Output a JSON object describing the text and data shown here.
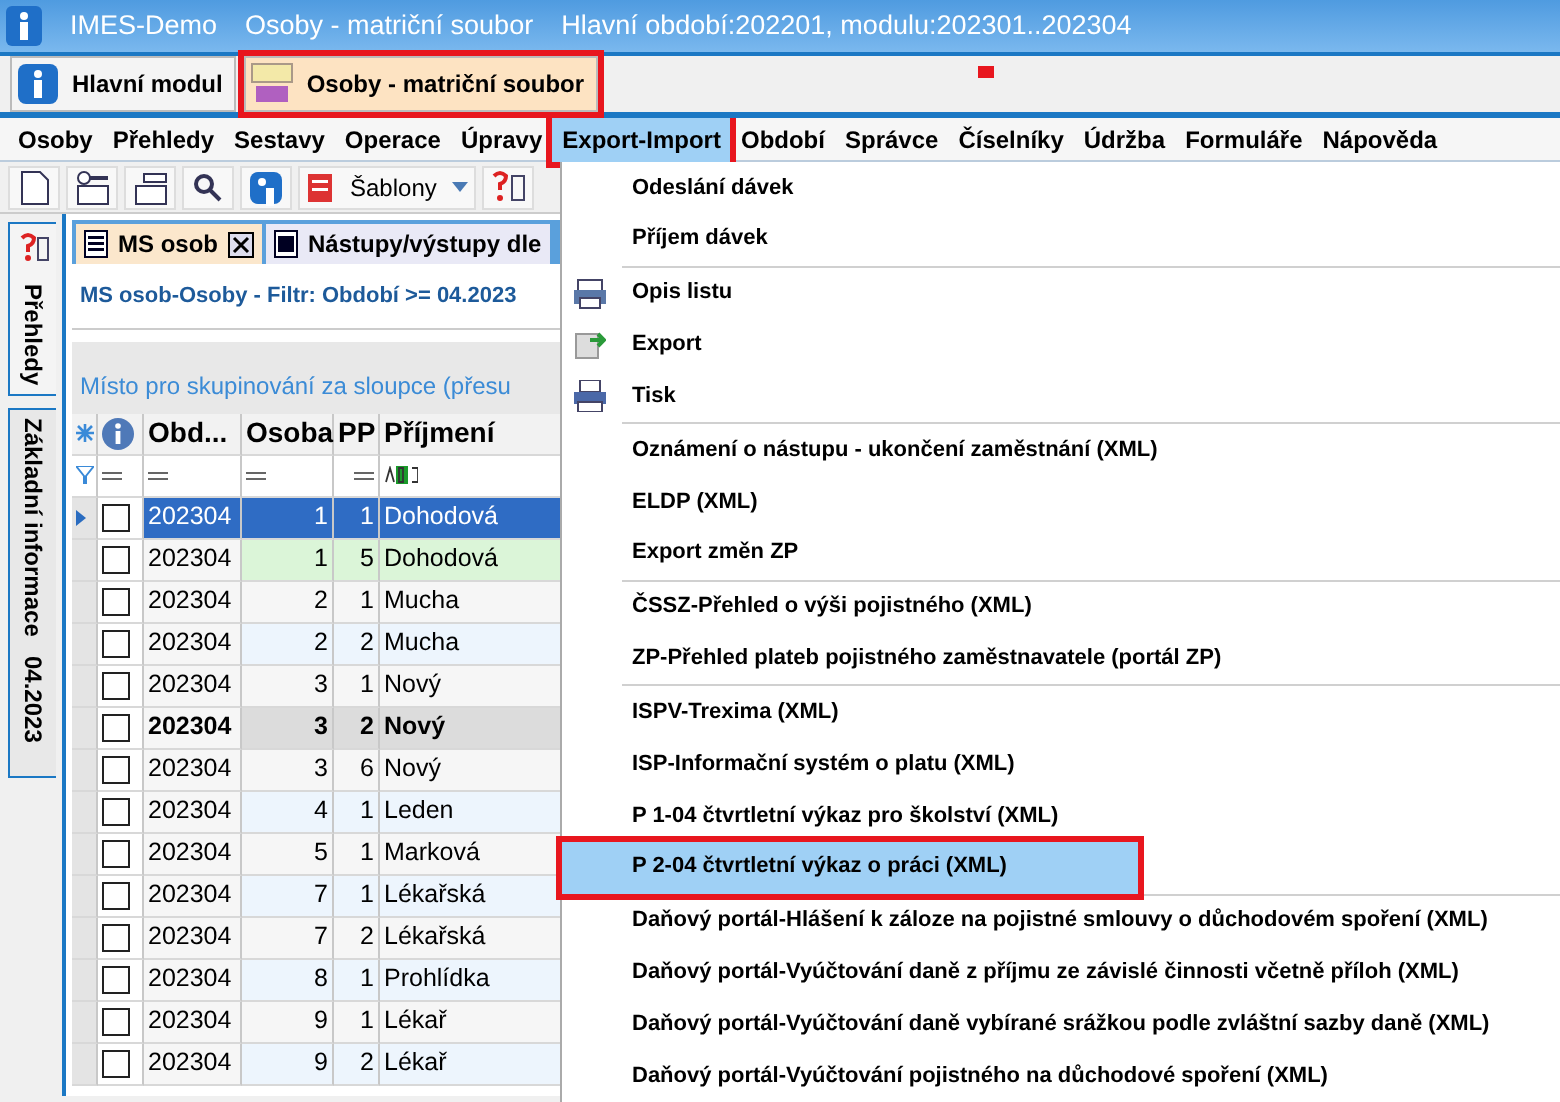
{
  "window": {
    "title": "IMES-Demo",
    "document": "Osoby - matriční soubor",
    "period": "Hlavní období:202201, modulu:202301..202304"
  },
  "module_tabs": [
    {
      "label": "Hlavní modul",
      "selected": false,
      "marked": false,
      "kind": "info"
    },
    {
      "label": "Osoby - matriční soubor",
      "selected": true,
      "marked": true,
      "kind": "ms"
    }
  ],
  "menu": [
    {
      "label": "Osoby",
      "open": false,
      "marked": false
    },
    {
      "label": "Přehledy",
      "open": false,
      "marked": false
    },
    {
      "label": "Sestavy",
      "open": false,
      "marked": false
    },
    {
      "label": "Operace",
      "open": false,
      "marked": false
    },
    {
      "label": "Úpravy",
      "open": false,
      "marked": false
    },
    {
      "label": "Export-Import",
      "open": true,
      "marked": true
    },
    {
      "label": "Období",
      "open": false,
      "marked": false
    },
    {
      "label": "Správce",
      "open": false,
      "marked": false
    },
    {
      "label": "Číselníky",
      "open": false,
      "marked": false
    },
    {
      "label": "Údržba",
      "open": false,
      "marked": false
    },
    {
      "label": "Formuláře",
      "open": false,
      "marked": false
    },
    {
      "label": "Nápověda",
      "open": false,
      "marked": false
    }
  ],
  "toolbar": {
    "templates_button": "Šablony"
  },
  "side_tabs": [
    {
      "label": "Přehledy",
      "selected": false
    },
    {
      "label": "Základní informace",
      "extra": "04.2023",
      "selected": true
    }
  ],
  "doc_tabs": [
    {
      "label": "MS osob",
      "selected": true
    },
    {
      "label": "Nástupy/výstupy dle",
      "selected": false
    }
  ],
  "filter_caption": "MS osob-Osoby  -  Filtr: Období >= 04.2023",
  "group_panel": "Místo pro skupinování za sloupce (přesu",
  "table": {
    "columns": [
      "Obd...",
      "Osoba",
      "PP",
      "Příjmení"
    ],
    "rows": [
      {
        "cells": [
          "202304",
          "1",
          "1",
          "Dohodová"
        ],
        "selected": true,
        "checked": false,
        "kind": "plain"
      },
      {
        "cells": [
          "202304",
          "1",
          "5",
          "Dohodová"
        ],
        "selected": false,
        "checked": false,
        "kind": "green"
      },
      {
        "cells": [
          "202304",
          "2",
          "1",
          "Mucha"
        ],
        "selected": false,
        "checked": false,
        "kind": "plain"
      },
      {
        "cells": [
          "202304",
          "2",
          "2",
          "Mucha"
        ],
        "selected": false,
        "checked": false,
        "kind": "plain"
      },
      {
        "cells": [
          "202304",
          "3",
          "1",
          "Nový"
        ],
        "selected": false,
        "checked": false,
        "kind": "plain"
      },
      {
        "cells": [
          "202304",
          "3",
          "2",
          "Nový"
        ],
        "selected": false,
        "checked": false,
        "kind": "bold"
      },
      {
        "cells": [
          "202304",
          "3",
          "6",
          "Nový"
        ],
        "selected": false,
        "checked": false,
        "kind": "plain"
      },
      {
        "cells": [
          "202304",
          "4",
          "1",
          "Leden"
        ],
        "selected": false,
        "checked": false,
        "kind": "plain"
      },
      {
        "cells": [
          "202304",
          "5",
          "1",
          "Marková"
        ],
        "selected": false,
        "checked": false,
        "kind": "plain"
      },
      {
        "cells": [
          "202304",
          "7",
          "1",
          "Lékařská"
        ],
        "selected": false,
        "checked": false,
        "kind": "plain"
      },
      {
        "cells": [
          "202304",
          "7",
          "2",
          "Lékařská"
        ],
        "selected": false,
        "checked": false,
        "kind": "plain"
      },
      {
        "cells": [
          "202304",
          "8",
          "1",
          "Prohlídka"
        ],
        "selected": false,
        "checked": false,
        "kind": "plain"
      },
      {
        "cells": [
          "202304",
          "9",
          "1",
          "Lékař"
        ],
        "selected": false,
        "checked": false,
        "kind": "plain"
      },
      {
        "cells": [
          "202304",
          "9",
          "2",
          "Lékař"
        ],
        "selected": false,
        "checked": false,
        "kind": "plain"
      }
    ]
  },
  "dropdown": [
    {
      "kind": "item",
      "label": "Odeslání dávek",
      "selected": false,
      "marked": false
    },
    {
      "kind": "item",
      "label": "Příjem dávek",
      "selected": false,
      "marked": false
    },
    {
      "kind": "separator"
    },
    {
      "kind": "printer",
      "label": "Opis listu",
      "selected": false,
      "marked": false
    },
    {
      "kind": "export",
      "label": "Export",
      "selected": false,
      "marked": false
    },
    {
      "kind": "print",
      "label": "Tisk",
      "selected": false,
      "marked": false
    },
    {
      "kind": "separator"
    },
    {
      "kind": "item",
      "label": "Oznámení o nástupu - ukončení zaměstnání (XML)",
      "selected": false,
      "marked": false
    },
    {
      "kind": "item",
      "label": "ELDP (XML)",
      "selected": false,
      "marked": false
    },
    {
      "kind": "item",
      "label": "Export změn ZP",
      "selected": false,
      "marked": false
    },
    {
      "kind": "separator"
    },
    {
      "kind": "item",
      "label": "ČSSZ-Přehled o výši pojistného (XML)",
      "selected": false,
      "marked": false
    },
    {
      "kind": "item",
      "label": "ZP-Přehled plateb pojistného zaměstnavatele (portál ZP)",
      "selected": false,
      "marked": false
    },
    {
      "kind": "separator"
    },
    {
      "kind": "item",
      "label": "ISPV-Trexima (XML)",
      "selected": false,
      "marked": false
    },
    {
      "kind": "item",
      "label": "ISP-Informační systém o platu (XML)",
      "selected": false,
      "marked": false
    },
    {
      "kind": "item",
      "label": "P 1-04 čtvrtletní výkaz pro školství (XML)",
      "selected": false,
      "marked": false
    },
    {
      "kind": "item",
      "label": "P 2-04 čtvrtletní výkaz o práci (XML)",
      "selected": true,
      "marked": true
    },
    {
      "kind": "separator"
    },
    {
      "kind": "item",
      "label": "Daňový portál-Hlášení k záloze na pojistné smlouvy o důchodovém spoření (XML)",
      "selected": false,
      "marked": false
    },
    {
      "kind": "item",
      "label": "Daňový portál-Vyúčtování daně z příjmu ze závislé činnosti včetně příloh (XML)",
      "selected": false,
      "marked": false
    },
    {
      "kind": "item",
      "label": "Daňový portál-Vyúčtování daně vybírané srážkou podle zvláštní sazby daně  (XML)",
      "selected": false,
      "marked": false
    },
    {
      "kind": "item",
      "label": "Daňový portál-Vyúčtování pojistného na důchodové spoření (XML)",
      "selected": false,
      "marked": false
    }
  ]
}
